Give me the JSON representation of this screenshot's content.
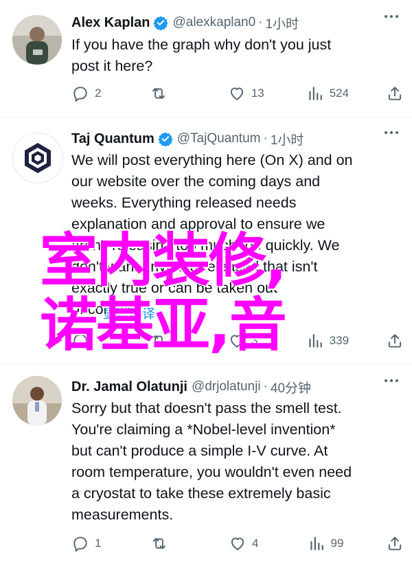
{
  "tweets": [
    {
      "name": "Alex Kaplan",
      "handle": "@alexkaplan0",
      "time": "1小时",
      "lines": [
        "If you have the graph why don't you just",
        "post it here?"
      ],
      "replies": "2",
      "reposts": "",
      "likes": "13",
      "views": "524"
    },
    {
      "name": "Taj Quantum",
      "handle": "@TajQuantum",
      "time": "1小时",
      "lines": [
        "We will post everything here (On X) and on",
        "our website over the coming days and",
        "weeks. Everything released needs",
        "explanation and approval to ensure we",
        "aren't releasing too much too quickly. We",
        "don't want anything released that isn't",
        "exactly true or can be taken out",
        "of context."
      ],
      "show_translation": "显示翻译",
      "replies": "",
      "reposts": "",
      "likes": "3",
      "views": "339"
    },
    {
      "name": "Dr. Jamal Olatunji",
      "handle": "@drjolatunji",
      "time": "40分钟",
      "lines": [
        "Sorry but that doesn't pass the smell test.",
        "You're claiming a *Nobel-level invention*",
        "but can't produce a simple I-V curve. At",
        "room temperature, you wouldn't even need",
        "a cryostat to take these extremely basic",
        "measurements."
      ],
      "replies": "1",
      "reposts": "",
      "likes": "4",
      "views": "99"
    }
  ],
  "separator": "·",
  "overlay": {
    "line1": "室内装修,",
    "line2": "诺基亚,音"
  },
  "colors": {
    "verified": "#1d9bf0",
    "secondary_text": "#536471",
    "overlay": "#ff00ff"
  }
}
